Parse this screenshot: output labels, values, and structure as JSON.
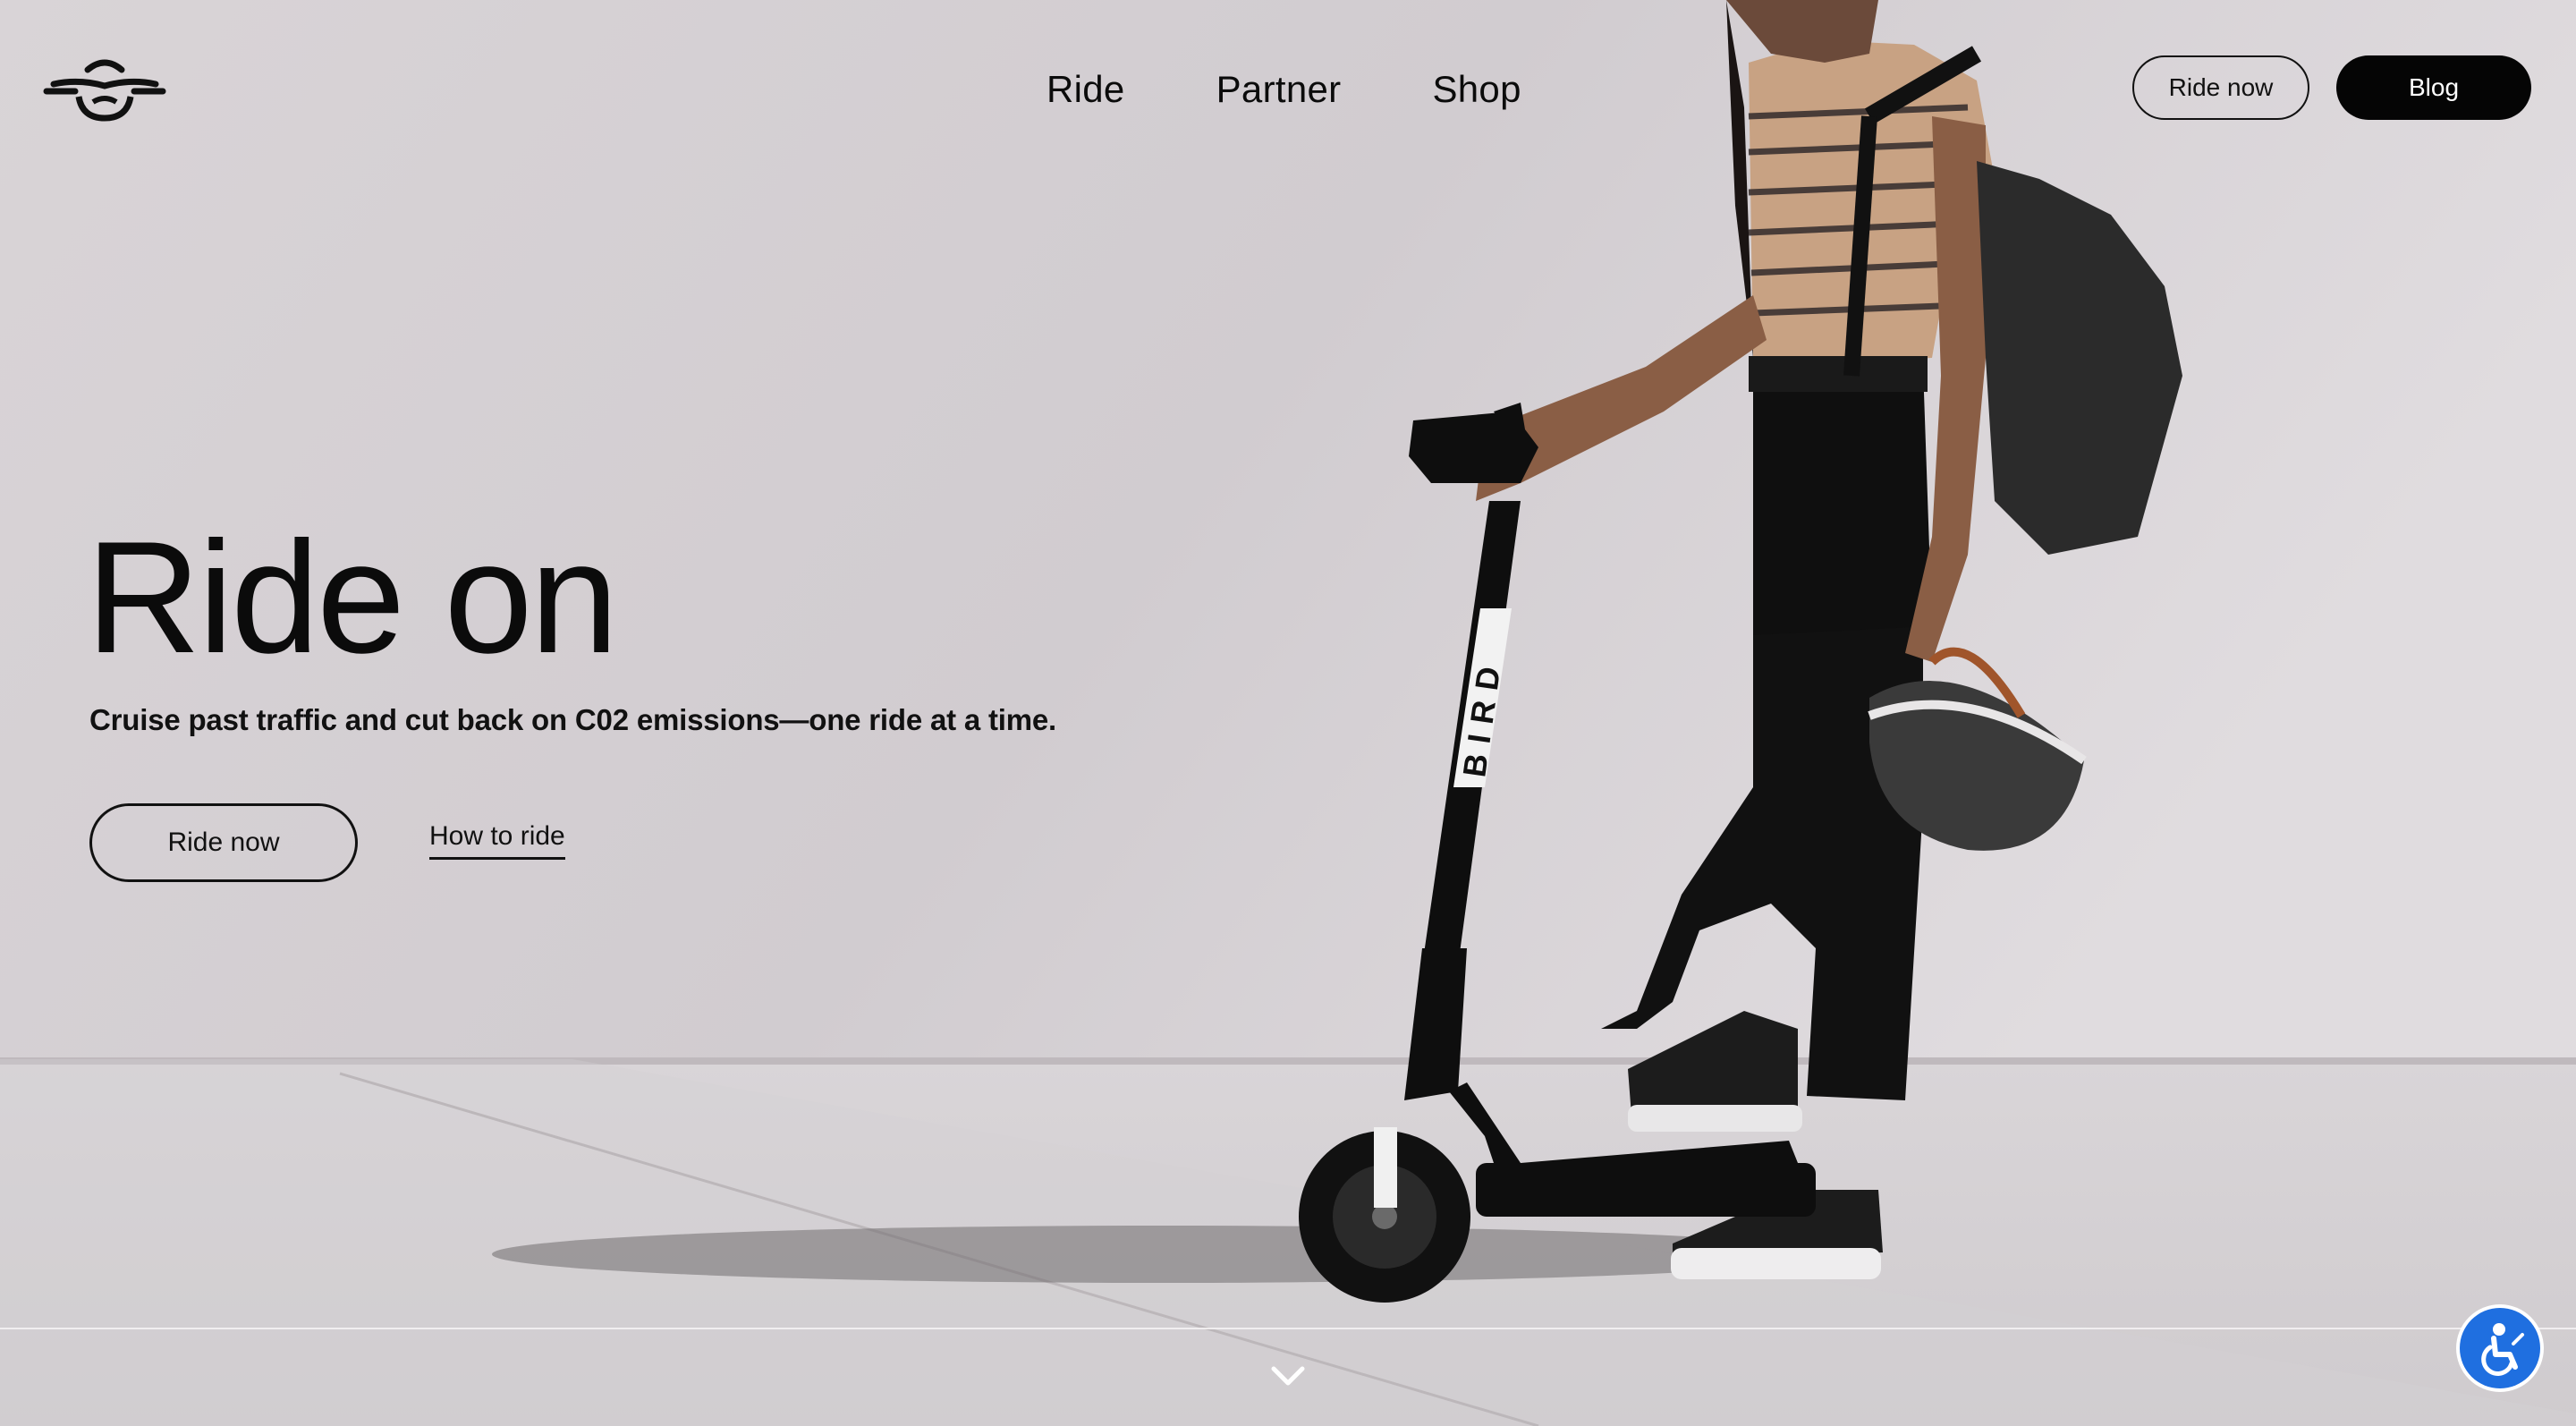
{
  "header": {
    "logo_icon": "bird-logo-icon",
    "nav": [
      {
        "label": "Ride"
      },
      {
        "label": "Partner"
      },
      {
        "label": "Shop"
      }
    ],
    "ride_now_label": "Ride now",
    "blog_label": "Blog"
  },
  "hero": {
    "title": "Ride on",
    "subtitle": "Cruise past traffic and cut back on C02 emissions—one ride at a time.",
    "primary_button": "Ride now",
    "secondary_link": "How to ride",
    "scooter_text": "BIRD"
  },
  "footer": {
    "scroll_icon": "chevron-down-icon",
    "accessibility_icon": "accessibility-icon"
  },
  "colors": {
    "accent": "#1f6fe0",
    "dark": "#050505",
    "wall": "#d3cfd2"
  }
}
